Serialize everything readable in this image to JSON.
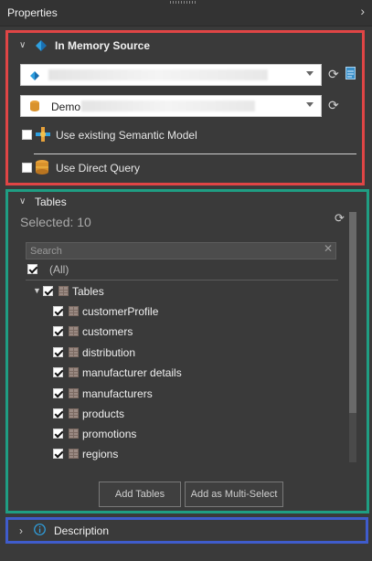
{
  "header": {
    "title": "Properties"
  },
  "source": {
    "title": "In Memory Source",
    "database_value": "Demo",
    "use_semantic_label": "Use existing Semantic Model",
    "use_direct_query_label": "Use Direct Query"
  },
  "tables": {
    "title": "Tables",
    "selected_text": "Selected: 10",
    "search_placeholder": "Search",
    "all_label": "(All)",
    "root_label": "Tables",
    "items": [
      {
        "label": "customerProfile"
      },
      {
        "label": "customers"
      },
      {
        "label": "distribution"
      },
      {
        "label": "manufacturer details"
      },
      {
        "label": "manufacturers"
      },
      {
        "label": "products"
      },
      {
        "label": "promotions"
      },
      {
        "label": "regions"
      }
    ],
    "add_tables_label": "Add Tables",
    "add_multi_label": "Add as Multi-Select"
  },
  "description": {
    "title": "Description"
  },
  "colors": {
    "red_box": "#e04545",
    "green_box": "#1f9e83",
    "blue_box": "#3f5ccc",
    "bg": "#3a3a3a"
  }
}
